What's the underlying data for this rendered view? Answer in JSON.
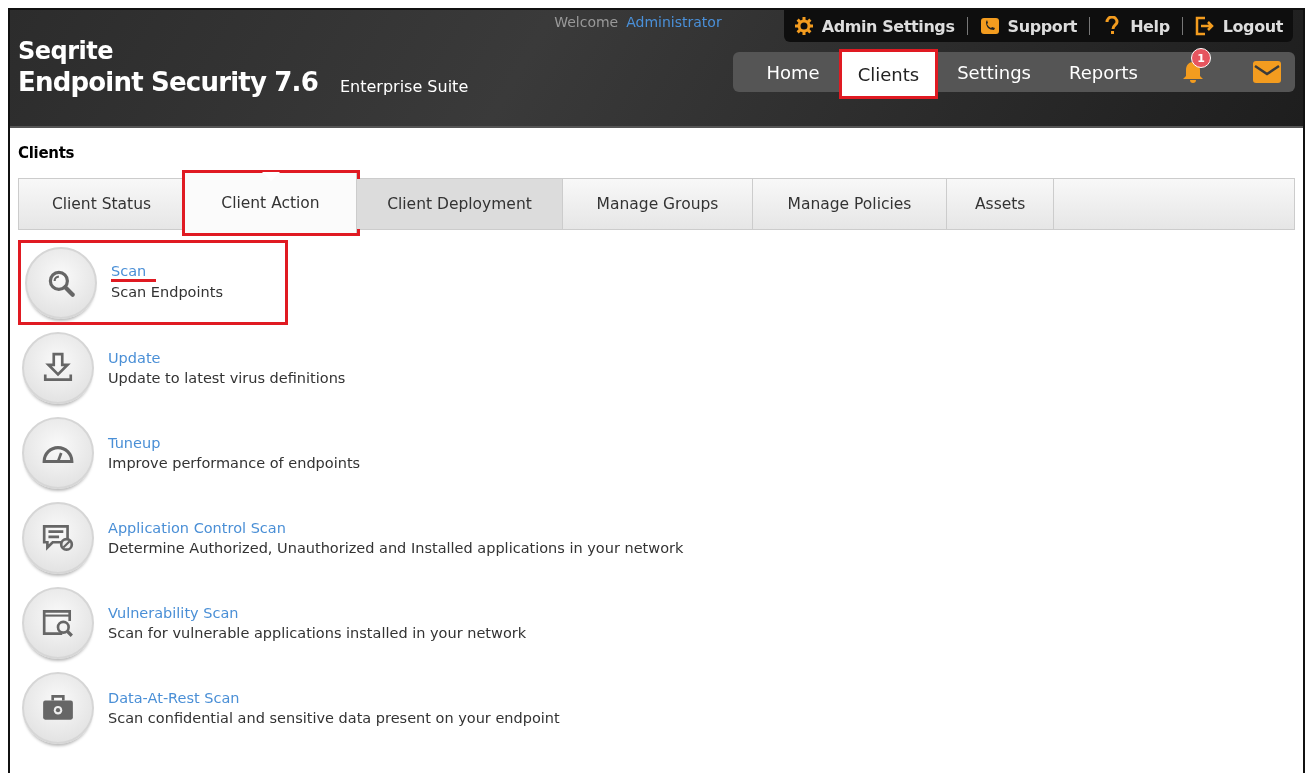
{
  "header": {
    "brand": "Seqrite",
    "product": "Endpoint Security 7.6",
    "edition": "Enterprise Suite",
    "welcome": "Welcome",
    "user": "Administrator",
    "top_links": [
      {
        "kind": "gear",
        "label": "Admin Settings"
      },
      {
        "kind": "phone",
        "label": "Support"
      },
      {
        "kind": "question",
        "label": "Help"
      },
      {
        "kind": "logout",
        "label": "Logout"
      }
    ],
    "nav": [
      {
        "label": "Home",
        "selected": false,
        "highlighted": false
      },
      {
        "label": "Clients",
        "selected": true,
        "highlighted": true
      },
      {
        "label": "Settings",
        "selected": false,
        "highlighted": false
      },
      {
        "label": "Reports",
        "selected": false,
        "highlighted": false
      }
    ],
    "notification_count": "1"
  },
  "page_title": "Clients",
  "tabs": [
    {
      "label": "Client Status",
      "selected": false,
      "highlighted": false
    },
    {
      "label": "Client Action",
      "selected": true,
      "highlighted": true
    },
    {
      "label": "Client Deployment",
      "selected": false,
      "highlighted": false
    },
    {
      "label": "Manage Groups",
      "selected": false,
      "highlighted": false
    },
    {
      "label": "Manage Policies",
      "selected": false,
      "highlighted": false
    },
    {
      "label": "Assets",
      "selected": false,
      "highlighted": false
    }
  ],
  "actions": [
    {
      "kind": "search",
      "title": "Scan",
      "description": "Scan Endpoints",
      "highlighted": true
    },
    {
      "kind": "download",
      "title": "Update",
      "description": "Update to latest virus definitions",
      "highlighted": false
    },
    {
      "kind": "gauge",
      "title": "Tuneup",
      "description": "Improve performance of endpoints",
      "highlighted": false
    },
    {
      "kind": "message",
      "title": "Application Control Scan",
      "description": "Determine Authorized, Unauthorized and Installed applications in your network",
      "highlighted": false
    },
    {
      "kind": "window",
      "title": "Vulnerability Scan",
      "description": "Scan for vulnerable applications installed in your network",
      "highlighted": false
    },
    {
      "kind": "briefcase",
      "title": "Data-At-Rest Scan",
      "description": "Scan confidential and sensitive data present on your endpoint",
      "highlighted": false
    }
  ]
}
